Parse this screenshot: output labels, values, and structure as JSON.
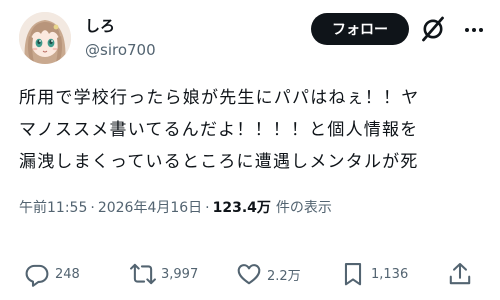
{
  "author": {
    "display_name": "しろ",
    "handle": "@siro700"
  },
  "header": {
    "follow_label": "フォロー",
    "grok_icon": "grok-slash-circle-icon",
    "more_icon": "more-icon"
  },
  "post": {
    "text_lines": [
      "所用で学校行ったら娘が先生にパパはねぇ！！ヤ",
      "マノススメ書いてるんだよ！！！！と個人情報を",
      "漏洩しまくっているところに遭遇しメンタルが死"
    ]
  },
  "meta": {
    "time": "午前11:55",
    "separator": "·",
    "date": "2026年4月16日",
    "views_count": "123.4万",
    "views_label": "件の表示"
  },
  "actions": {
    "reply": {
      "icon": "reply-icon",
      "count": "248"
    },
    "repost": {
      "icon": "repost-icon",
      "count": "3,997"
    },
    "like": {
      "icon": "heart-icon",
      "count": "2.2万"
    },
    "bookmark": {
      "icon": "bookmark-icon",
      "count": "1,136"
    },
    "share": {
      "icon": "share-icon"
    }
  },
  "colors": {
    "primary_text": "#0f1419",
    "secondary_text": "#536471",
    "follow_button_bg": "#0f1419",
    "follow_button_text": "#ffffff",
    "background": "#ffffff"
  }
}
